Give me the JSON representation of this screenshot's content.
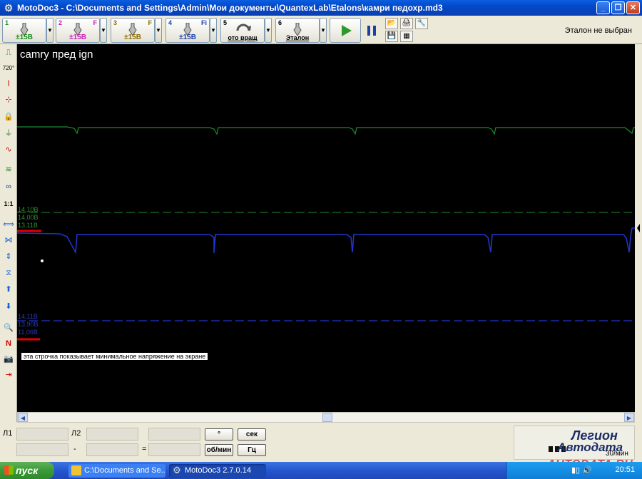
{
  "window": {
    "title": "MotoDoc3 - C:\\Documents and Settings\\Admin\\Мои документы\\QuantexLab\\Etalons\\камри педохр.md3"
  },
  "toolbar": {
    "channels": [
      {
        "num": "1",
        "mode": "",
        "range": "±15В",
        "color": "#1d8a1d"
      },
      {
        "num": "2",
        "mode": "F",
        "range": "±15В",
        "color": "#c81eb4"
      },
      {
        "num": "3",
        "mode": "F",
        "range": "±15В",
        "color": "#8a6d00"
      },
      {
        "num": "4",
        "mode": "Fi",
        "range": "±15В",
        "color": "#1c3fa8"
      }
    ],
    "rotation_label": "ото вращ",
    "rotation_num": "5",
    "etalon_label": "Эталон",
    "etalon_num": "6",
    "etalon_status": "Эталон не выбран"
  },
  "left_toolbar": {
    "items": [
      "25%-icon",
      "720-icon",
      "ch-view-icon",
      "cursor-icon",
      "lock-icon",
      "trigger-icon",
      "sine-icon",
      "waves-icon",
      "overlay-icon",
      "1:1",
      "h-expand-icon",
      "h-shrink-icon",
      "v-expand-icon",
      "v-shrink-icon",
      "up-icon",
      "down-icon",
      "zoom-icon",
      "n-icon",
      "print-icon",
      "export-icon"
    ],
    "ratio_label": "1:1"
  },
  "scope": {
    "record_title": "camry пред ign",
    "green_labels": [
      "14,10В",
      "14,00В",
      "13,11В"
    ],
    "blue_labels": [
      "14,11В",
      "13,90В",
      "11,06В"
    ],
    "note": "эта строчка показывает минимальное напряжение на экране"
  },
  "bottom": {
    "l1_label": "Л1",
    "l2_label": "Л2",
    "minus": "-",
    "equals": "=",
    "deg_btn": "°",
    "sec_btn": "сек",
    "rpm_btn": "об/мин",
    "hz_btn": "Гц",
    "logo_line1": "Легион",
    "logo_line2": "Автодата",
    "logo_line3": "30/мин",
    "watermark": "AUTODATA.RU"
  },
  "taskbar": {
    "start_label": "пуск",
    "tasks": [
      "C:\\Documents and Se...",
      "MotoDoc3 2.7.0.14"
    ],
    "clock": "20:51"
  },
  "colors": {
    "trace_green": "#1e8a2e",
    "trace_blue": "#1f34c8",
    "marker_red": "#e00000"
  }
}
